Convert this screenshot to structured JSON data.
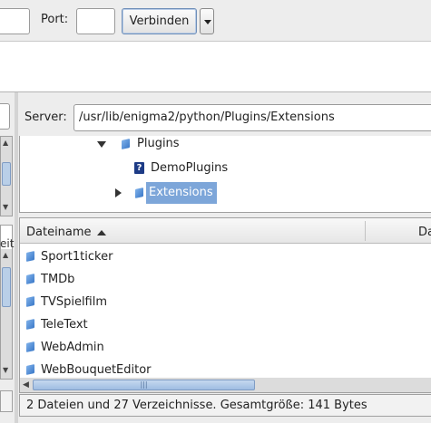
{
  "toolbar": {
    "host_value": "",
    "port_label": "Port:",
    "port_value": "",
    "connect_label": "Verbinden"
  },
  "local": {
    "header_fragment": "eit"
  },
  "server": {
    "label": "Server:",
    "path": "/usr/lib/enigma2/python/Plugins/Extensions",
    "tree": [
      {
        "label": "Plugins",
        "icon": "folder-icon",
        "expanded": true
      },
      {
        "label": "DemoPlugins",
        "icon": "unknown-file-icon"
      },
      {
        "label": "Extensions",
        "icon": "folder-icon",
        "expanded": false,
        "selected": true
      }
    ],
    "columns": {
      "name": "Dateiname",
      "size_fragment": "Da"
    },
    "files": [
      {
        "name": "Sport1ticker"
      },
      {
        "name": "TMDb"
      },
      {
        "name": "TVSpielfilm"
      },
      {
        "name": "TeleText"
      },
      {
        "name": "WebAdmin"
      },
      {
        "name": "WebBouquetEditor"
      }
    ],
    "status": "2 Dateien und 27 Verzeichnisse. Gesamtgröße: 141 Bytes"
  },
  "colors": {
    "selection": "#7da6d9",
    "folder": "#3a78c8",
    "scroll_thumb": "#9fbde2"
  }
}
